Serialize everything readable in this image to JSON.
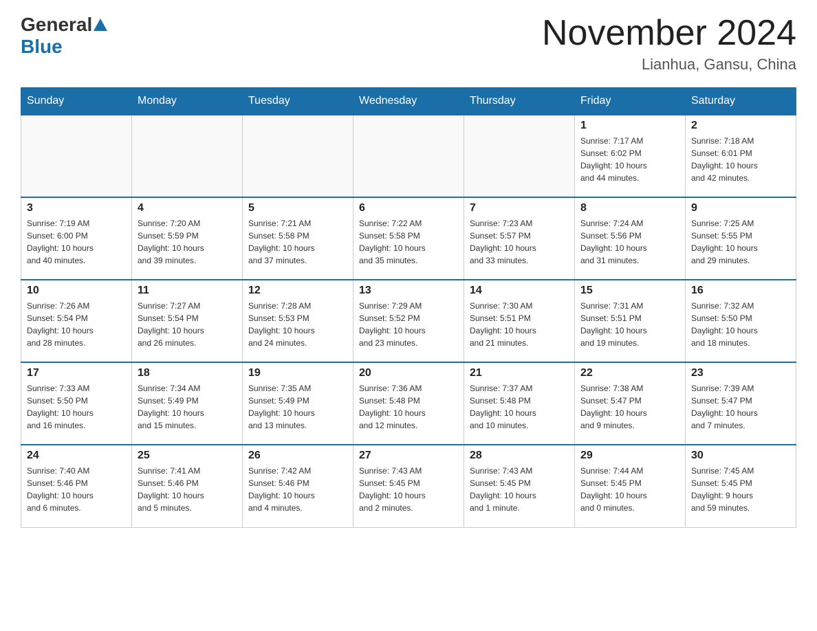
{
  "header": {
    "logo": {
      "general": "General",
      "blue": "Blue"
    },
    "title": "November 2024",
    "location": "Lianhua, Gansu, China"
  },
  "days_of_week": [
    "Sunday",
    "Monday",
    "Tuesday",
    "Wednesday",
    "Thursday",
    "Friday",
    "Saturday"
  ],
  "weeks": [
    [
      {
        "day": "",
        "info": ""
      },
      {
        "day": "",
        "info": ""
      },
      {
        "day": "",
        "info": ""
      },
      {
        "day": "",
        "info": ""
      },
      {
        "day": "",
        "info": ""
      },
      {
        "day": "1",
        "info": "Sunrise: 7:17 AM\nSunset: 6:02 PM\nDaylight: 10 hours\nand 44 minutes."
      },
      {
        "day": "2",
        "info": "Sunrise: 7:18 AM\nSunset: 6:01 PM\nDaylight: 10 hours\nand 42 minutes."
      }
    ],
    [
      {
        "day": "3",
        "info": "Sunrise: 7:19 AM\nSunset: 6:00 PM\nDaylight: 10 hours\nand 40 minutes."
      },
      {
        "day": "4",
        "info": "Sunrise: 7:20 AM\nSunset: 5:59 PM\nDaylight: 10 hours\nand 39 minutes."
      },
      {
        "day": "5",
        "info": "Sunrise: 7:21 AM\nSunset: 5:58 PM\nDaylight: 10 hours\nand 37 minutes."
      },
      {
        "day": "6",
        "info": "Sunrise: 7:22 AM\nSunset: 5:58 PM\nDaylight: 10 hours\nand 35 minutes."
      },
      {
        "day": "7",
        "info": "Sunrise: 7:23 AM\nSunset: 5:57 PM\nDaylight: 10 hours\nand 33 minutes."
      },
      {
        "day": "8",
        "info": "Sunrise: 7:24 AM\nSunset: 5:56 PM\nDaylight: 10 hours\nand 31 minutes."
      },
      {
        "day": "9",
        "info": "Sunrise: 7:25 AM\nSunset: 5:55 PM\nDaylight: 10 hours\nand 29 minutes."
      }
    ],
    [
      {
        "day": "10",
        "info": "Sunrise: 7:26 AM\nSunset: 5:54 PM\nDaylight: 10 hours\nand 28 minutes."
      },
      {
        "day": "11",
        "info": "Sunrise: 7:27 AM\nSunset: 5:54 PM\nDaylight: 10 hours\nand 26 minutes."
      },
      {
        "day": "12",
        "info": "Sunrise: 7:28 AM\nSunset: 5:53 PM\nDaylight: 10 hours\nand 24 minutes."
      },
      {
        "day": "13",
        "info": "Sunrise: 7:29 AM\nSunset: 5:52 PM\nDaylight: 10 hours\nand 23 minutes."
      },
      {
        "day": "14",
        "info": "Sunrise: 7:30 AM\nSunset: 5:51 PM\nDaylight: 10 hours\nand 21 minutes."
      },
      {
        "day": "15",
        "info": "Sunrise: 7:31 AM\nSunset: 5:51 PM\nDaylight: 10 hours\nand 19 minutes."
      },
      {
        "day": "16",
        "info": "Sunrise: 7:32 AM\nSunset: 5:50 PM\nDaylight: 10 hours\nand 18 minutes."
      }
    ],
    [
      {
        "day": "17",
        "info": "Sunrise: 7:33 AM\nSunset: 5:50 PM\nDaylight: 10 hours\nand 16 minutes."
      },
      {
        "day": "18",
        "info": "Sunrise: 7:34 AM\nSunset: 5:49 PM\nDaylight: 10 hours\nand 15 minutes."
      },
      {
        "day": "19",
        "info": "Sunrise: 7:35 AM\nSunset: 5:49 PM\nDaylight: 10 hours\nand 13 minutes."
      },
      {
        "day": "20",
        "info": "Sunrise: 7:36 AM\nSunset: 5:48 PM\nDaylight: 10 hours\nand 12 minutes."
      },
      {
        "day": "21",
        "info": "Sunrise: 7:37 AM\nSunset: 5:48 PM\nDaylight: 10 hours\nand 10 minutes."
      },
      {
        "day": "22",
        "info": "Sunrise: 7:38 AM\nSunset: 5:47 PM\nDaylight: 10 hours\nand 9 minutes."
      },
      {
        "day": "23",
        "info": "Sunrise: 7:39 AM\nSunset: 5:47 PM\nDaylight: 10 hours\nand 7 minutes."
      }
    ],
    [
      {
        "day": "24",
        "info": "Sunrise: 7:40 AM\nSunset: 5:46 PM\nDaylight: 10 hours\nand 6 minutes."
      },
      {
        "day": "25",
        "info": "Sunrise: 7:41 AM\nSunset: 5:46 PM\nDaylight: 10 hours\nand 5 minutes."
      },
      {
        "day": "26",
        "info": "Sunrise: 7:42 AM\nSunset: 5:46 PM\nDaylight: 10 hours\nand 4 minutes."
      },
      {
        "day": "27",
        "info": "Sunrise: 7:43 AM\nSunset: 5:45 PM\nDaylight: 10 hours\nand 2 minutes."
      },
      {
        "day": "28",
        "info": "Sunrise: 7:43 AM\nSunset: 5:45 PM\nDaylight: 10 hours\nand 1 minute."
      },
      {
        "day": "29",
        "info": "Sunrise: 7:44 AM\nSunset: 5:45 PM\nDaylight: 10 hours\nand 0 minutes."
      },
      {
        "day": "30",
        "info": "Sunrise: 7:45 AM\nSunset: 5:45 PM\nDaylight: 9 hours\nand 59 minutes."
      }
    ]
  ]
}
